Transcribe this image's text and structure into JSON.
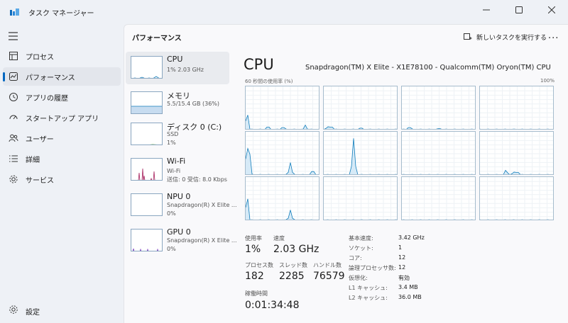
{
  "window": {
    "title": "タスク マネージャー",
    "controls": [
      "minimize-icon",
      "maximize-icon",
      "close-icon"
    ]
  },
  "nav": {
    "items": [
      {
        "label": "プロセス",
        "icon": "processes-icon"
      },
      {
        "label": "パフォーマンス",
        "icon": "performance-icon",
        "active": true
      },
      {
        "label": "アプリの履歴",
        "icon": "app-history-icon"
      },
      {
        "label": "スタートアップ アプリ",
        "icon": "startup-icon"
      },
      {
        "label": "ユーザー",
        "icon": "users-icon"
      },
      {
        "label": "詳細",
        "icon": "details-icon"
      },
      {
        "label": "サービス",
        "icon": "services-icon"
      }
    ],
    "settings_label": "設定"
  },
  "header": {
    "title": "パフォーマンス",
    "run_task_label": "新しいタスクを実行する",
    "more_label": "..."
  },
  "resources": [
    {
      "name": "CPU",
      "sub": [
        "1% 2.03 GHz"
      ]
    },
    {
      "name": "メモリ",
      "sub": [
        "5.5/15.4 GB (36%)"
      ]
    },
    {
      "name": "ディスク 0 (C:)",
      "sub": [
        "SSD",
        "1%"
      ]
    },
    {
      "name": "Wi-Fi",
      "sub": [
        "Wi-Fi",
        "送信: 0 受信: 8.0 Kbps"
      ]
    },
    {
      "name": "NPU 0",
      "sub": [
        "Snapdragon(R) X Elite ...",
        "0%"
      ]
    },
    {
      "name": "GPU 0",
      "sub": [
        "Snapdragon(R) X Elite ...",
        "0%"
      ]
    }
  ],
  "cpu": {
    "title": "CPU",
    "model": "Snapdragon(TM) X Elite - X1E78100 - Qualcomm(TM) Oryon(TM) CPU",
    "graph_caption": "60 秒間の使用率 (%)",
    "graph_max": "100%",
    "stats": {
      "usage_label": "使用率",
      "usage_value": "1%",
      "speed_label": "速度",
      "speed_value": "2.03 GHz",
      "processes_label": "プロセス数",
      "processes_value": "182",
      "threads_label": "スレッド数",
      "threads_value": "2285",
      "handles_label": "ハンドル数",
      "handles_value": "76579",
      "uptime_label": "稼働時間",
      "uptime_value": "0:01:34:48"
    },
    "specs": [
      {
        "label": "基本速度:",
        "value": "3.42 GHz"
      },
      {
        "label": "ソケット:",
        "value": "1"
      },
      {
        "label": "コア:",
        "value": "12"
      },
      {
        "label": "論理プロセッサ数:",
        "value": "12"
      },
      {
        "label": "仮想化:",
        "value": "有効"
      },
      {
        "label": "L1 キャッシュ:",
        "value": "3.4 MB"
      },
      {
        "label": "L2 キャッシュ:",
        "value": "36.0 MB"
      }
    ]
  },
  "colors": {
    "accent": "#0067c0",
    "cpu_line": "#117dbb",
    "cpu_fill": "#d6eaf7",
    "memory_fill": "#c7dcf0",
    "wifi_line": "#a7235e",
    "gpu_line": "#7b3fbf"
  }
}
